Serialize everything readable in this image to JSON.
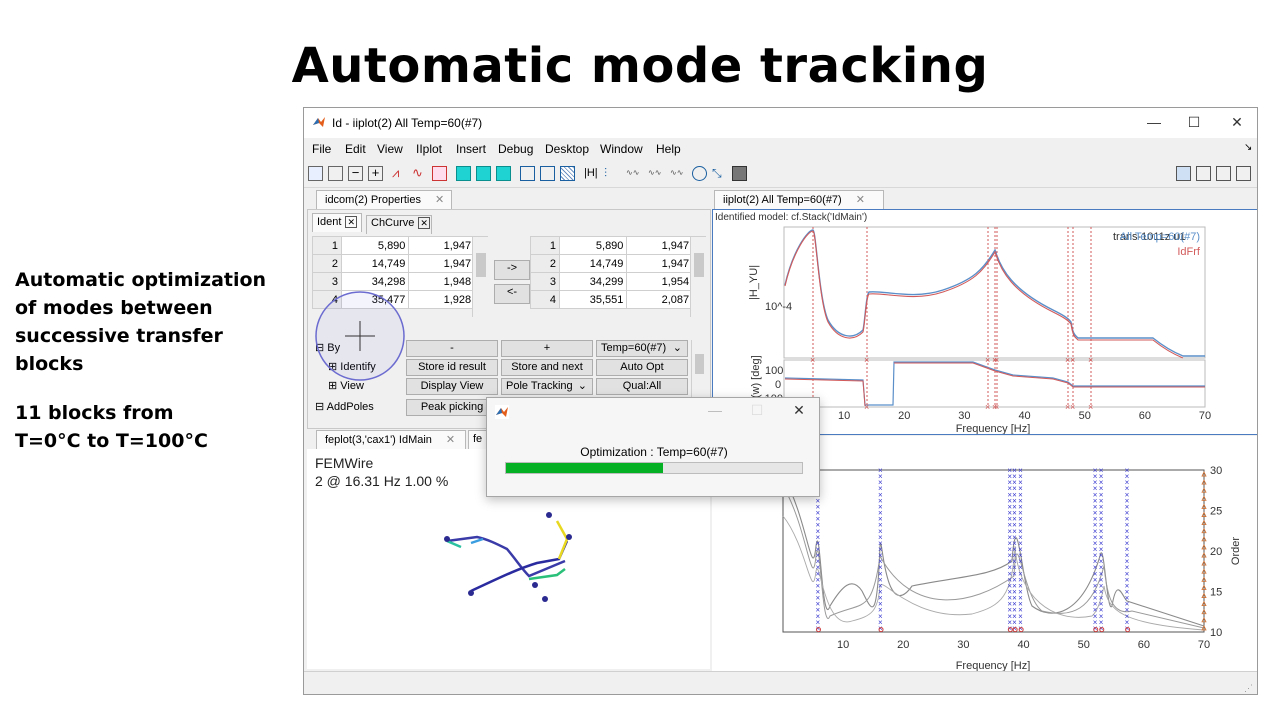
{
  "slide": {
    "title": "Automatic mode tracking",
    "side_lines": [
      "Automatic optimization",
      "of modes between",
      "successive transfer",
      "blocks"
    ],
    "side_lines2": [
      "11 blocks from",
      "T=0°C to T=100°C"
    ]
  },
  "window": {
    "title": "Id - iiplot(2) All Temp=60(#7)",
    "controls": {
      "minimize": "—",
      "maximize": "☐",
      "close": "✕"
    },
    "menu": [
      "File",
      "Edit",
      "View",
      "IIplot",
      "Insert",
      "Debug",
      "Desktop",
      "Window",
      "Help"
    ]
  },
  "left_panel": {
    "tab": "idcom(2) Properties",
    "subtabs": [
      "Ident",
      "ChCurve"
    ],
    "table_left": [
      [
        "1",
        "5,890",
        "1,947 %"
      ],
      [
        "2",
        "14,749",
        "1,947 %"
      ],
      [
        "3",
        "34,298",
        "1,948 %"
      ],
      [
        "4",
        "35,477",
        "1,928 %"
      ]
    ],
    "table_right": [
      [
        "1",
        "5,890",
        "1,947 %"
      ],
      [
        "2",
        "14,749",
        "1,947 %"
      ],
      [
        "3",
        "34,299",
        "1,954 %"
      ],
      [
        "4",
        "35,551",
        "2,087 %"
      ]
    ],
    "copy_right": "->",
    "copy_left": "<-",
    "tree": {
      "by": "By",
      "identify": "Identify",
      "view": "View",
      "addpoles": "AddPoles"
    },
    "buttons": {
      "minus": "-",
      "plus": "+",
      "temp_select": "Temp=60(#7)",
      "store_id": "Store id result",
      "store_next": "Store and next",
      "auto_opt": "Auto Opt",
      "display_view": "Display View",
      "pole_tracking": "Pole Tracking",
      "qual_all": "Qual:All",
      "peak_picking": "Peak picking"
    }
  },
  "right_panel": {
    "tab": "iiplot(2) All Temp=60(#7)",
    "model_label": "Identified model: cf.Stack('IdMain')",
    "legend": {
      "channel": "trans-1011z u1",
      "series1": "All Temp=60(#7)",
      "series2": "IdFrf"
    },
    "ylabel_mag": "|H_YU|",
    "ylabel_phase": "∠(w) [deg]",
    "xlabel": "Frequency [Hz]",
    "colors": {
      "series1": "#5b8fc9",
      "series2": "#d25a5a"
    }
  },
  "bottom_left": {
    "tab": "feplot(3,'cax1') IdMain",
    "tab2": "fe",
    "line1": "FEMWire",
    "line2": "2 @ 16.31 Hz 1.00 %"
  },
  "stab": {
    "xlabel": "Frequency [Hz]",
    "ylabel": "Order"
  },
  "dialog": {
    "label": "Optimization : Temp=60(#7)",
    "progress": 0.53,
    "controls": {
      "minimize": "—",
      "maximize": "☐",
      "close": "✕"
    }
  },
  "chart_data": [
    {
      "type": "line",
      "title": "",
      "xlabel": "Frequency [Hz]",
      "ylabel": "|H_YU|",
      "xlim": [
        0,
        70
      ],
      "x_ticks": [
        10,
        20,
        30,
        40,
        50,
        60,
        70
      ],
      "y_ticks": [
        "10^-4"
      ],
      "yscale": "log",
      "series": [
        {
          "name": "All Temp=60(#7)",
          "x": [
            1,
            5.9,
            10,
            14.7,
            20,
            30,
            35.5,
            40,
            47,
            48,
            52,
            60,
            70
          ],
          "y": [
            5e-05,
            0.008,
            0.0001,
            2e-05,
            0.0003,
            0.001,
            0.005,
            0.0006,
            0.0001,
            3e-05,
            2e-05,
            1e-05,
            2e-06
          ]
        },
        {
          "name": "IdFrf",
          "x": [
            1,
            5.9,
            10,
            14.7,
            20,
            30,
            35.5,
            40,
            47,
            48,
            52,
            60,
            70
          ],
          "y": [
            5e-05,
            0.008,
            0.0001,
            2e-05,
            0.0003,
            0.001,
            0.005,
            0.0006,
            0.0001,
            3e-05,
            2e-05,
            1e-05,
            2e-06
          ]
        }
      ],
      "pole_markers_hz": [
        5.9,
        14.7,
        34.3,
        35.5,
        47.5,
        48.2,
        52.0
      ]
    },
    {
      "type": "line",
      "xlabel": "Frequency [Hz]",
      "ylabel": "∠(w) [deg]",
      "xlim": [
        0,
        70
      ],
      "y_ticks": [
        100,
        0,
        -100
      ],
      "series": [
        {
          "name": "phase",
          "x": [
            1,
            14,
            15,
            19,
            20,
            35,
            40,
            47,
            50,
            70
          ],
          "y": [
            0,
            -20,
            -180,
            -180,
            160,
            120,
            -60,
            -40,
            -70,
            -80
          ]
        }
      ]
    },
    {
      "type": "scatter",
      "xlabel": "Frequency [Hz]",
      "ylabel": "Order",
      "xlim": [
        0,
        70
      ],
      "ylim": [
        10,
        30
      ],
      "x_ticks": [
        10,
        20,
        30,
        40,
        50,
        60,
        70
      ],
      "y_ticks": [
        10,
        15,
        20,
        25,
        30
      ],
      "pole_columns_hz": [
        5.9,
        16.3,
        37.8,
        38.6,
        39.6,
        52.0,
        53.0,
        57.3
      ]
    }
  ]
}
